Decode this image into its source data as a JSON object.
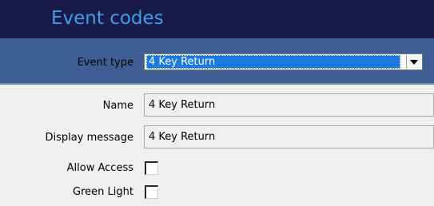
{
  "header": {
    "title": "Event codes"
  },
  "event_type": {
    "label": "Event type",
    "selected": "4 Key Return"
  },
  "form": {
    "name": {
      "label": "Name",
      "value": "4 Key Return"
    },
    "display_message": {
      "label": "Display message",
      "value": "4 Key Return"
    },
    "allow_access": {
      "label": "Allow Access",
      "checked": false
    },
    "green_light": {
      "label": "Green Light",
      "checked": false
    }
  },
  "colors": {
    "header_bg": "#1a1a4a",
    "header_text": "#3a9ee8",
    "typebar_bg": "#3e5e93",
    "selection": "#1a7ae0",
    "panel_bg": "#f0f0f0"
  },
  "icons": {
    "dropdown": "chevron-down-icon"
  }
}
